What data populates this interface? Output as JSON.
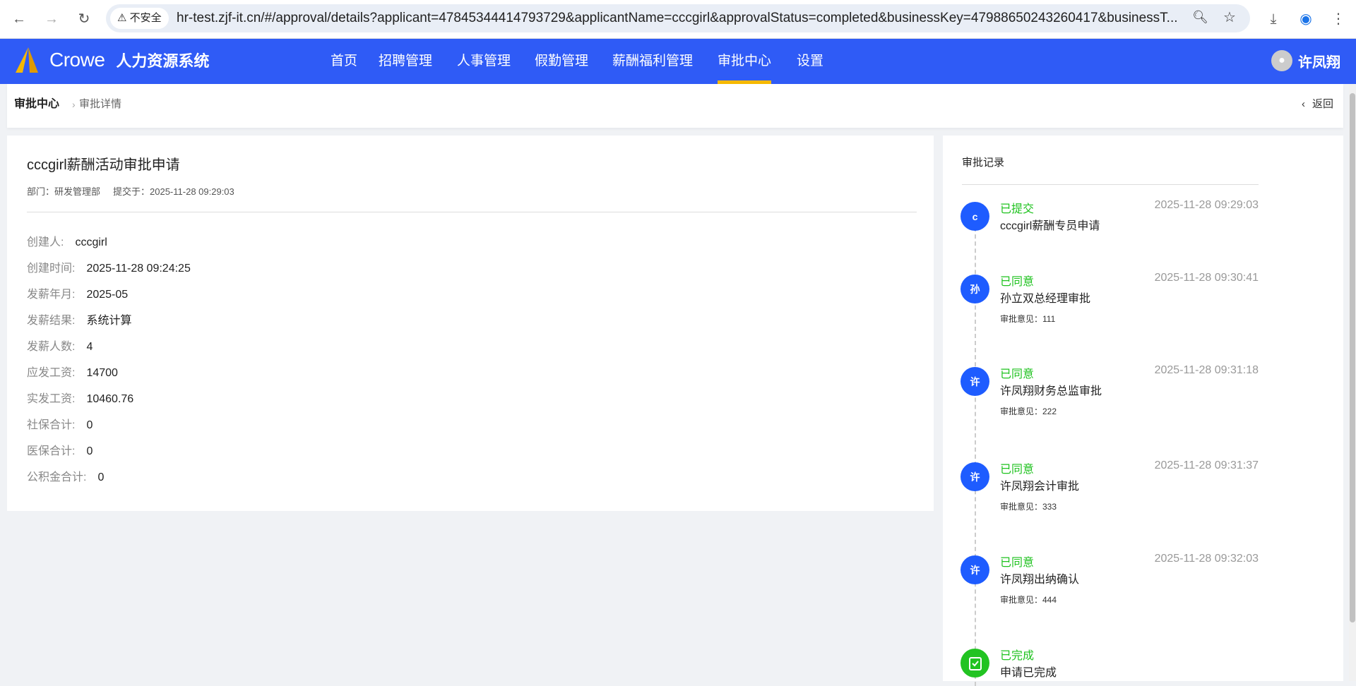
{
  "browser": {
    "insecure_label": "不安全",
    "url": "hr-test.zjf-it.cn/#/approval/details?applicant=47845344414793729&applicantName=cccgirl&approvalStatus=completed&businessKey=47988650243260417&businessT..."
  },
  "nav": {
    "brand": "Crowe",
    "system": "人力资源系统",
    "items": [
      "首页",
      "招聘管理",
      "人事管理",
      "假勤管理",
      "薪酬福利管理",
      "审批中心",
      "设置"
    ],
    "active": "审批中心",
    "user": "许凤翔"
  },
  "breadcrumb": {
    "parent": "审批中心",
    "current": "审批详情",
    "back": "返回"
  },
  "detail": {
    "title": "cccgirl薪酬活动审批申请",
    "department": "部门：研发管理部",
    "submitted": "提交于：2025-11-28 09:29:03",
    "fields": [
      {
        "label": "创建人:",
        "value": "cccgirl"
      },
      {
        "label": "创建时间:",
        "value": "2025-11-28 09:24:25"
      },
      {
        "label": "发薪年月:",
        "value": "2025-05"
      },
      {
        "label": "发薪结果:",
        "value": "系统计算"
      },
      {
        "label": "发薪人数:",
        "value": "4"
      },
      {
        "label": "应发工资:",
        "value": "14700"
      },
      {
        "label": "实发工资:",
        "value": "10460.76"
      },
      {
        "label": "社保合计:",
        "value": "0"
      },
      {
        "label": "医保合计:",
        "value": "0"
      },
      {
        "label": "公积金合计:",
        "value": "0"
      }
    ]
  },
  "records": {
    "title": "审批记录",
    "items": [
      {
        "avatar": "c",
        "status": "已提交",
        "time": "2025-11-28 09:29:03",
        "desc": "cccgirl薪酬专员申请",
        "opinion": ""
      },
      {
        "avatar": "孙",
        "status": "已同意",
        "time": "2025-11-28 09:30:41",
        "desc": "孙立双总经理审批",
        "opinion": "审批意见：111"
      },
      {
        "avatar": "许",
        "status": "已同意",
        "time": "2025-11-28 09:31:18",
        "desc": "许凤翔财务总监审批",
        "opinion": "审批意见：222"
      },
      {
        "avatar": "许",
        "status": "已同意",
        "time": "2025-11-28 09:31:37",
        "desc": "许凤翔会计审批",
        "opinion": "审批意见：333"
      },
      {
        "avatar": "许",
        "status": "已同意",
        "time": "2025-11-28 09:32:03",
        "desc": "许凤翔出纳确认",
        "opinion": "审批意见：444"
      },
      {
        "avatar": "",
        "status": "已完成",
        "time": "",
        "desc": "申请已完成",
        "opinion": ""
      }
    ]
  },
  "colors": {
    "nav": "#2f5bf6",
    "active_underline": "#f5b800",
    "status_green": "#1ec21e",
    "avatar_blue": "#1e5cff"
  }
}
